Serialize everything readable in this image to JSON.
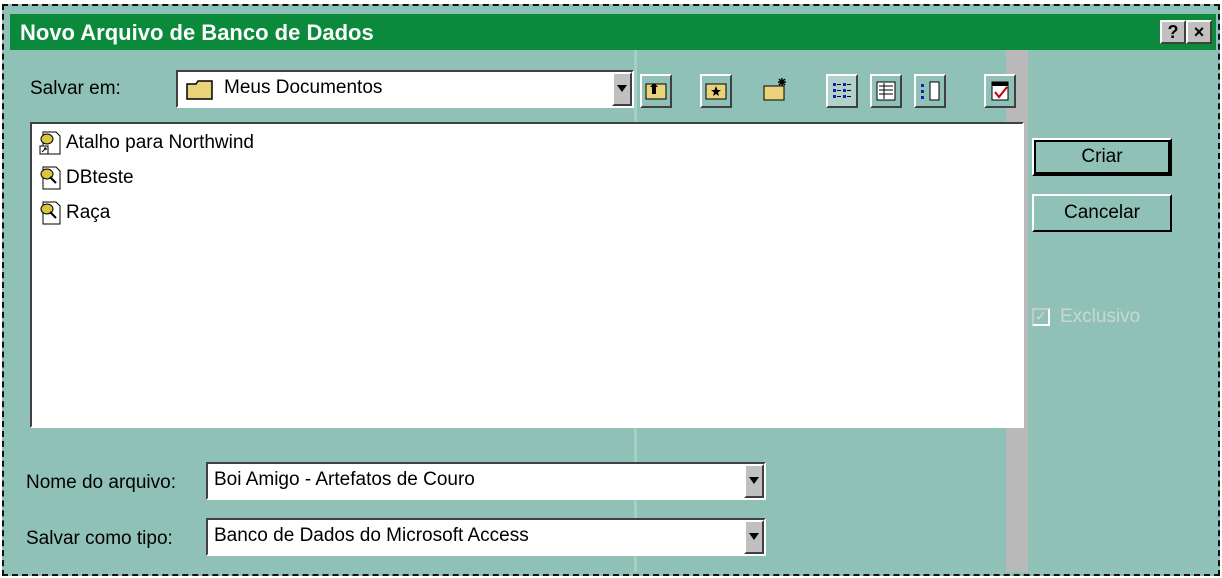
{
  "window": {
    "title": "Novo Arquivo de Banco de Dados",
    "help_label": "?",
    "close_label": "×"
  },
  "save_in": {
    "label": "Salvar em:",
    "value": "Meus Documentos"
  },
  "toolbar": {
    "icons": [
      "up-folder-icon",
      "favorites-folder-icon",
      "new-folder-icon",
      "list-view-icon",
      "details-view-icon",
      "properties-view-icon",
      "commands-icon"
    ]
  },
  "files": [
    {
      "name": "Atalho para Northwind",
      "icon": "shortcut-database-icon"
    },
    {
      "name": "DBteste",
      "icon": "database-icon"
    },
    {
      "name": "Raça",
      "icon": "database-icon"
    }
  ],
  "buttons": {
    "create": "Criar",
    "cancel": "Cancelar"
  },
  "exclusive": {
    "label": "Exclusivo",
    "checked": true,
    "enabled": false
  },
  "filename": {
    "label": "Nome do arquivo:",
    "value": "Boi Amigo - Artefatos de Couro"
  },
  "filetype": {
    "label": "Salvar como tipo:",
    "value": "Banco de Dados do Microsoft Access"
  },
  "colors": {
    "title_bar": "#0a8a3a",
    "dialog_bg": "#8fc1b6"
  }
}
